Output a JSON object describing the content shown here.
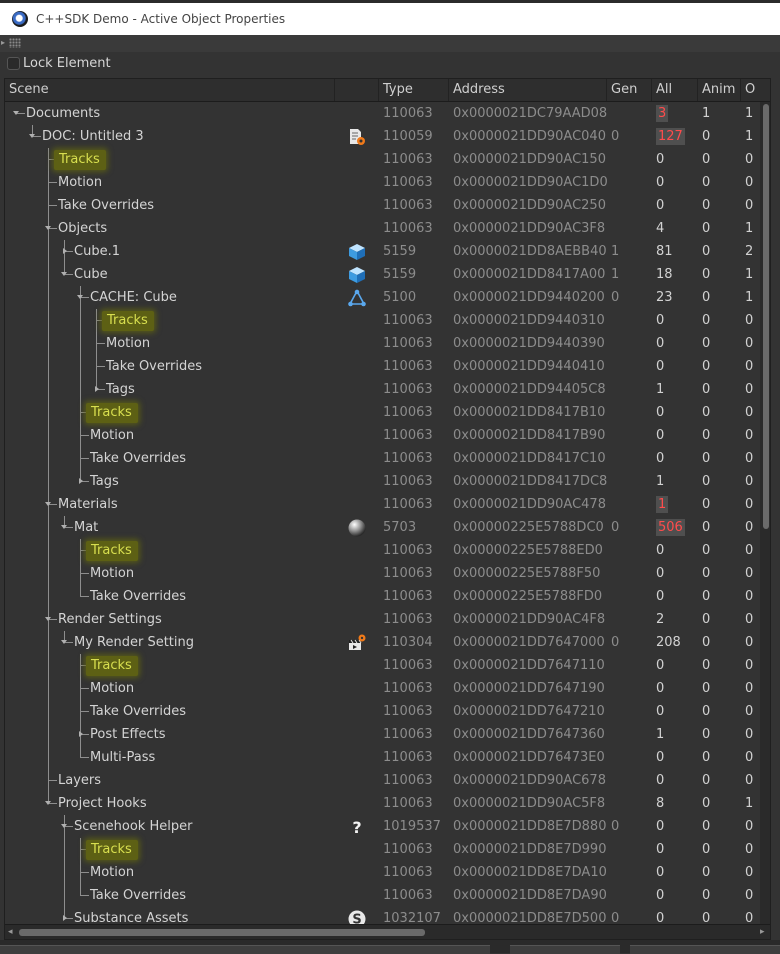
{
  "window": {
    "title": "C++SDK Demo - Active Object Properties",
    "icon": "cinema4d-logo-icon"
  },
  "lock_element": {
    "label": "Lock Element",
    "checked": false
  },
  "columns": {
    "scene": "Scene",
    "type": "Type",
    "address": "Address",
    "gen": "Gen",
    "all": "All",
    "anim": "Anim",
    "o": "O"
  },
  "colors": {
    "highlight_bg": "#5d6014",
    "highlight_text": "#d8df4f",
    "alert_red": "#ff4c4c"
  },
  "rows": [
    {
      "depth": 0,
      "expander": "open",
      "name": "Documents",
      "type": "110063",
      "address": "0x0000021DC79AAD08",
      "gen": "",
      "all": "3",
      "all_red": true,
      "anim": "1",
      "o": "1"
    },
    {
      "depth": 1,
      "expander": "open",
      "name": "DOC: Untitled 3",
      "icon": "document-settings-icon",
      "type": "110059",
      "address": "0x0000021DD90AC040",
      "gen": "0",
      "all": "127",
      "all_red": true,
      "anim": "0",
      "o": "1"
    },
    {
      "depth": 2,
      "expander": "none",
      "name": "Tracks",
      "highlight": true,
      "type": "110063",
      "address": "0x0000021DD90AC150",
      "gen": "",
      "all": "0",
      "anim": "0",
      "o": "0"
    },
    {
      "depth": 2,
      "expander": "none",
      "name": "Motion",
      "type": "110063",
      "address": "0x0000021DD90AC1D0",
      "gen": "",
      "all": "0",
      "anim": "0",
      "o": "0"
    },
    {
      "depth": 2,
      "expander": "none",
      "name": "Take Overrides",
      "type": "110063",
      "address": "0x0000021DD90AC250",
      "gen": "",
      "all": "0",
      "anim": "0",
      "o": "0"
    },
    {
      "depth": 2,
      "expander": "open",
      "name": "Objects",
      "type": "110063",
      "address": "0x0000021DD90AC3F8",
      "gen": "",
      "all": "4",
      "anim": "0",
      "o": "1"
    },
    {
      "depth": 3,
      "expander": "closed",
      "name": "Cube.1",
      "icon": "cube-icon",
      "type": "5159",
      "address": "0x0000021DD8AEBB40",
      "gen": "1",
      "all": "81",
      "anim": "0",
      "o": "2"
    },
    {
      "depth": 3,
      "expander": "open",
      "name": "Cube",
      "icon": "cube-icon",
      "type": "5159",
      "address": "0x0000021DD8417A00",
      "gen": "1",
      "all": "18",
      "anim": "0",
      "o": "1"
    },
    {
      "depth": 4,
      "expander": "open",
      "name": "CACHE: Cube",
      "icon": "polygon-icon",
      "type": "5100",
      "address": "0x0000021DD9440200",
      "gen": "0",
      "all": "23",
      "anim": "0",
      "o": "1"
    },
    {
      "depth": 5,
      "expander": "none",
      "name": "Tracks",
      "highlight": true,
      "type": "110063",
      "address": "0x0000021DD9440310",
      "gen": "",
      "all": "0",
      "anim": "0",
      "o": "0"
    },
    {
      "depth": 5,
      "expander": "none",
      "name": "Motion",
      "type": "110063",
      "address": "0x0000021DD9440390",
      "gen": "",
      "all": "0",
      "anim": "0",
      "o": "0"
    },
    {
      "depth": 5,
      "expander": "none",
      "name": "Take Overrides",
      "type": "110063",
      "address": "0x0000021DD9440410",
      "gen": "",
      "all": "0",
      "anim": "0",
      "o": "0"
    },
    {
      "depth": 5,
      "expander": "closed",
      "name": "Tags",
      "last": true,
      "type": "110063",
      "address": "0x0000021DD94405C8",
      "gen": "",
      "all": "1",
      "anim": "0",
      "o": "0"
    },
    {
      "depth": 4,
      "expander": "none",
      "name": "Tracks",
      "highlight": true,
      "type": "110063",
      "address": "0x0000021DD8417B10",
      "gen": "",
      "all": "0",
      "anim": "0",
      "o": "0"
    },
    {
      "depth": 4,
      "expander": "none",
      "name": "Motion",
      "type": "110063",
      "address": "0x0000021DD8417B90",
      "gen": "",
      "all": "0",
      "anim": "0",
      "o": "0"
    },
    {
      "depth": 4,
      "expander": "none",
      "name": "Take Overrides",
      "type": "110063",
      "address": "0x0000021DD8417C10",
      "gen": "",
      "all": "0",
      "anim": "0",
      "o": "0"
    },
    {
      "depth": 4,
      "expander": "closed",
      "name": "Tags",
      "last": true,
      "type": "110063",
      "address": "0x0000021DD8417DC8",
      "gen": "",
      "all": "1",
      "anim": "0",
      "o": "0"
    },
    {
      "depth": 2,
      "expander": "open",
      "name": "Materials",
      "type": "110063",
      "address": "0x0000021DD90AC478",
      "gen": "",
      "all": "1",
      "all_red": true,
      "anim": "0",
      "o": "0"
    },
    {
      "depth": 3,
      "expander": "open",
      "name": "Mat",
      "icon": "material-sphere-icon",
      "type": "5703",
      "address": "0x00000225E5788DC0",
      "gen": "0",
      "all": "506",
      "all_red": true,
      "anim": "0",
      "o": "0"
    },
    {
      "depth": 4,
      "expander": "none",
      "name": "Tracks",
      "highlight": true,
      "type": "110063",
      "address": "0x00000225E5788ED0",
      "gen": "",
      "all": "0",
      "anim": "0",
      "o": "0"
    },
    {
      "depth": 4,
      "expander": "none",
      "name": "Motion",
      "type": "110063",
      "address": "0x00000225E5788F50",
      "gen": "",
      "all": "0",
      "anim": "0",
      "o": "0"
    },
    {
      "depth": 4,
      "expander": "none",
      "name": "Take Overrides",
      "last": true,
      "type": "110063",
      "address": "0x00000225E5788FD0",
      "gen": "",
      "all": "0",
      "anim": "0",
      "o": "0"
    },
    {
      "depth": 2,
      "expander": "open",
      "name": "Render Settings",
      "type": "110063",
      "address": "0x0000021DD90AC4F8",
      "gen": "",
      "all": "2",
      "anim": "0",
      "o": "0"
    },
    {
      "depth": 3,
      "expander": "open",
      "name": "My Render Setting",
      "icon": "render-settings-icon",
      "type": "110304",
      "address": "0x0000021DD7647000",
      "gen": "0",
      "all": "208",
      "anim": "0",
      "o": "0"
    },
    {
      "depth": 4,
      "expander": "none",
      "name": "Tracks",
      "highlight": true,
      "type": "110063",
      "address": "0x0000021DD7647110",
      "gen": "",
      "all": "0",
      "anim": "0",
      "o": "0"
    },
    {
      "depth": 4,
      "expander": "none",
      "name": "Motion",
      "type": "110063",
      "address": "0x0000021DD7647190",
      "gen": "",
      "all": "0",
      "anim": "0",
      "o": "0"
    },
    {
      "depth": 4,
      "expander": "none",
      "name": "Take Overrides",
      "type": "110063",
      "address": "0x0000021DD7647210",
      "gen": "",
      "all": "0",
      "anim": "0",
      "o": "0"
    },
    {
      "depth": 4,
      "expander": "closed",
      "name": "Post Effects",
      "type": "110063",
      "address": "0x0000021DD7647360",
      "gen": "",
      "all": "1",
      "anim": "0",
      "o": "0"
    },
    {
      "depth": 4,
      "expander": "none",
      "name": "Multi-Pass",
      "last": true,
      "type": "110063",
      "address": "0x0000021DD76473E0",
      "gen": "",
      "all": "0",
      "anim": "0",
      "o": "0"
    },
    {
      "depth": 2,
      "expander": "none",
      "name": "Layers",
      "type": "110063",
      "address": "0x0000021DD90AC678",
      "gen": "",
      "all": "0",
      "anim": "0",
      "o": "0"
    },
    {
      "depth": 2,
      "expander": "open",
      "name": "Project Hooks",
      "type": "110063",
      "address": "0x0000021DD90AC5F8",
      "gen": "",
      "all": "8",
      "anim": "0",
      "o": "1"
    },
    {
      "depth": 3,
      "expander": "open",
      "name": "Scenehook Helper",
      "icon": "question-icon",
      "type": "1019537",
      "address": "0x0000021DD8E7D880",
      "gen": "0",
      "all": "0",
      "anim": "0",
      "o": "0"
    },
    {
      "depth": 4,
      "expander": "none",
      "name": "Tracks",
      "highlight": true,
      "type": "110063",
      "address": "0x0000021DD8E7D990",
      "gen": "",
      "all": "0",
      "anim": "0",
      "o": "0"
    },
    {
      "depth": 4,
      "expander": "none",
      "name": "Motion",
      "type": "110063",
      "address": "0x0000021DD8E7DA10",
      "gen": "",
      "all": "0",
      "anim": "0",
      "o": "0"
    },
    {
      "depth": 4,
      "expander": "none",
      "name": "Take Overrides",
      "last": true,
      "type": "110063",
      "address": "0x0000021DD8E7DA90",
      "gen": "",
      "all": "0",
      "anim": "0",
      "o": "0"
    },
    {
      "depth": 3,
      "expander": "closed",
      "name": "Substance Assets",
      "icon": "substance-icon",
      "type": "1032107",
      "address": "0x0000021DD8E7D500",
      "gen": "0",
      "all": "0",
      "anim": "0",
      "o": "0"
    }
  ]
}
